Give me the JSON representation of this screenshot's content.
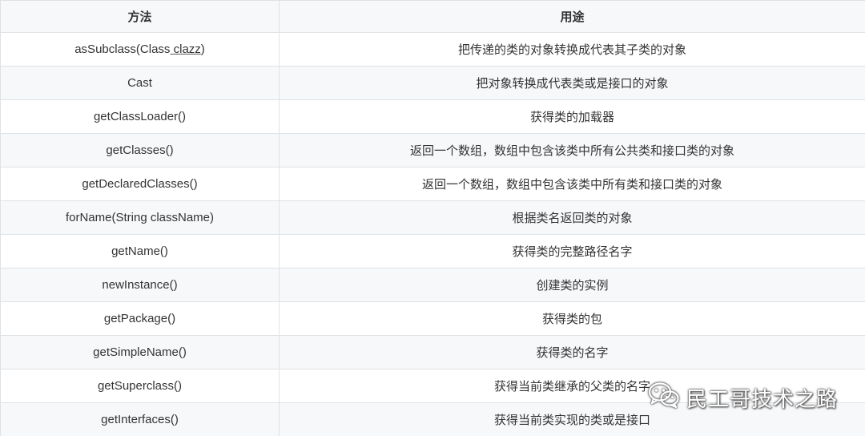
{
  "table": {
    "headers": {
      "method": "方法",
      "purpose": "用途"
    },
    "rows": [
      {
        "method_prefix": "asSubclass(Class",
        "method_under": " clazz",
        "method_suffix": ")",
        "purpose": "把传递的类的对象转换成代表其子类的对象"
      },
      {
        "method": "Cast",
        "purpose": "把对象转换成代表类或是接口的对象"
      },
      {
        "method": "getClassLoader()",
        "purpose": "获得类的加载器"
      },
      {
        "method": "getClasses()",
        "purpose": "返回一个数组，数组中包含该类中所有公共类和接口类的对象"
      },
      {
        "method": "getDeclaredClasses()",
        "purpose": "返回一个数组，数组中包含该类中所有类和接口类的对象"
      },
      {
        "method": "forName(String className)",
        "purpose": "根据类名返回类的对象"
      },
      {
        "method": "getName()",
        "purpose": "获得类的完整路径名字"
      },
      {
        "method": "newInstance()",
        "purpose": "创建类的实例"
      },
      {
        "method": "getPackage()",
        "purpose": "获得类的包"
      },
      {
        "method": "getSimpleName()",
        "purpose": "获得类的名字"
      },
      {
        "method": "getSuperclass()",
        "purpose": "获得当前类继承的父类的名字"
      },
      {
        "method": "getInterfaces()",
        "purpose": "获得当前类实现的类或是接口"
      }
    ]
  },
  "watermark": {
    "text": "民工哥技术之路",
    "icon": "wechat-icon"
  },
  "colors": {
    "header_bg": "#f6f8fa",
    "stripe_bg": "#f6f8fa",
    "border": "#dfe2e5",
    "text": "#333333"
  }
}
